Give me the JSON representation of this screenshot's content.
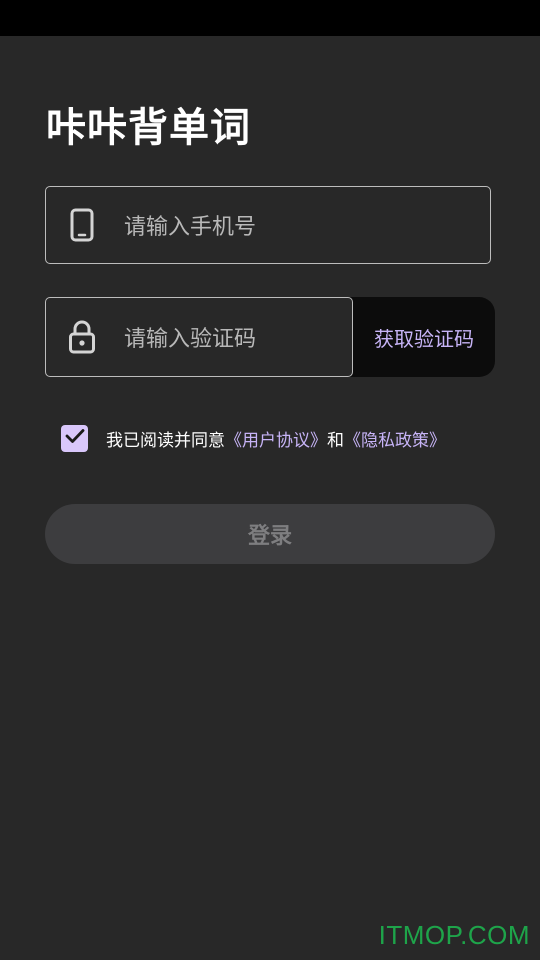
{
  "app": {
    "title": "咔咔背单词"
  },
  "phone_field": {
    "icon": "smartphone-icon",
    "placeholder": "请输入手机号"
  },
  "code_field": {
    "icon": "lock-icon",
    "placeholder": "请输入验证码",
    "get_code_label": "获取验证码"
  },
  "agreement": {
    "checked": true,
    "prefix": "我已阅读并同意",
    "user_agreement": "《用户协议》",
    "conjunction": "和",
    "privacy_policy": "《隐私政策》"
  },
  "login": {
    "label": "登录"
  },
  "watermark": {
    "text": "ITMOP.COM"
  },
  "colors": {
    "background": "#282828",
    "status_bar": "#000000",
    "accent": "#c7b4f7",
    "checkbox": "#d9c7fb",
    "login_disabled_bg": "#3d3d3f",
    "watermark": "#1ea44a"
  }
}
